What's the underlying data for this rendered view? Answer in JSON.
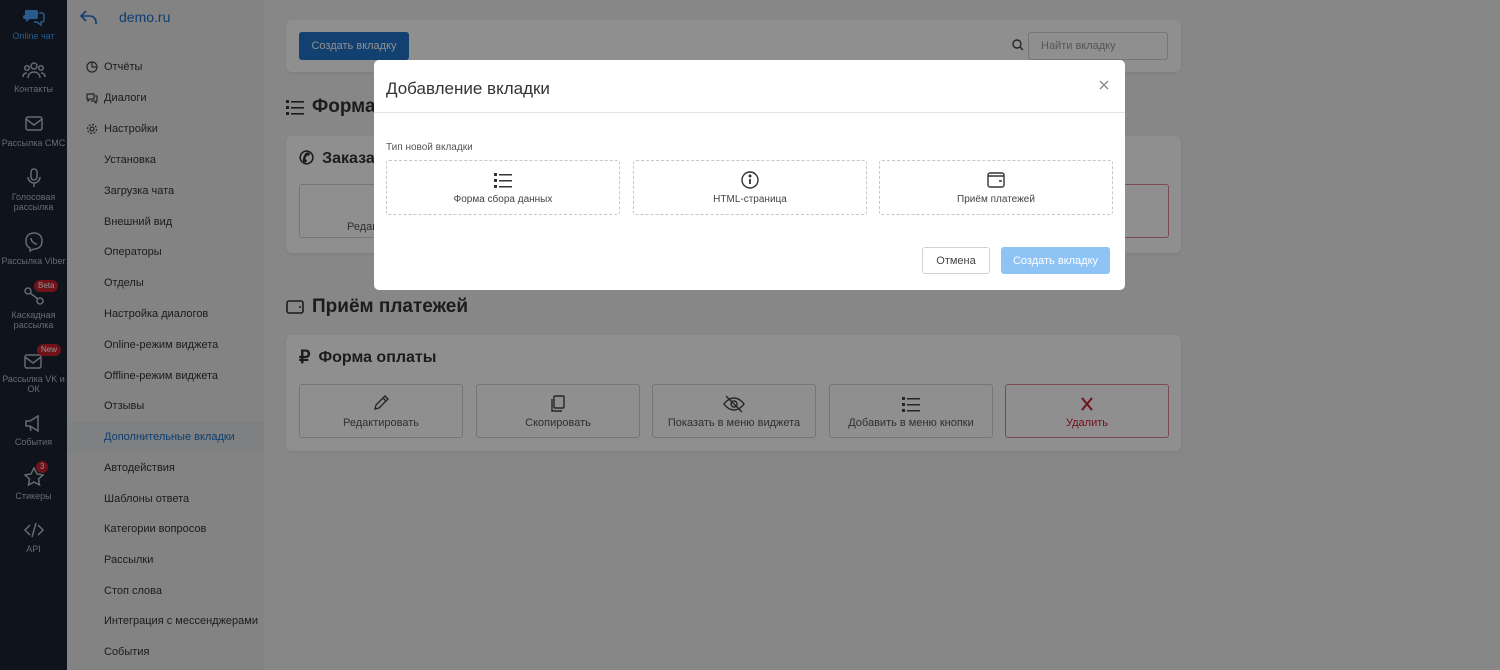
{
  "rail": {
    "items": [
      {
        "label": "Online чат",
        "icon": "chat-icon"
      },
      {
        "label": "Контакты",
        "icon": "contacts-icon"
      },
      {
        "label": "Рассылка СМС",
        "icon": "mail-icon"
      },
      {
        "label": "Голосовая рассылка",
        "icon": "microphone-icon"
      },
      {
        "label": "Рассылка Viber",
        "icon": "viber-icon"
      },
      {
        "label": "Каскадная рассылка",
        "icon": "cascade-icon",
        "badge": "Beta"
      },
      {
        "label": "Рассылка VK и ОК",
        "icon": "vk-ok-icon",
        "badge": "New"
      },
      {
        "label": "События",
        "icon": "megaphone-icon"
      },
      {
        "label": "Стикеры",
        "icon": "star-icon",
        "badge": "3"
      },
      {
        "label": "API",
        "icon": "code-icon"
      }
    ]
  },
  "sidebar": {
    "site": "demo.ru",
    "items": [
      {
        "label": "Отчёты",
        "icon": "reports-icon"
      },
      {
        "label": "Диалоги",
        "icon": "dialogs-icon"
      },
      {
        "label": "Настройки",
        "icon": "gear-icon"
      },
      {
        "label": "Установка"
      },
      {
        "label": "Загрузка чата"
      },
      {
        "label": "Внешний вид"
      },
      {
        "label": "Операторы"
      },
      {
        "label": "Отделы"
      },
      {
        "label": "Настройка диалогов"
      },
      {
        "label": "Online-режим виджета"
      },
      {
        "label": "Offline-режим виджета"
      },
      {
        "label": "Отзывы"
      },
      {
        "label": "Дополнительные вкладки",
        "active": true
      },
      {
        "label": "Автодействия"
      },
      {
        "label": "Шаблоны ответа"
      },
      {
        "label": "Категории вопросов"
      },
      {
        "label": "Рассылки"
      },
      {
        "label": "Стоп слова"
      },
      {
        "label": "Интеграция с мессенджерами"
      },
      {
        "label": "События"
      }
    ]
  },
  "toolbar": {
    "create_label": "Создать вкладку",
    "search_placeholder": "Найти вкладку"
  },
  "sections": {
    "form": {
      "title": "Форма",
      "card_title": "Заказат",
      "edit_partial": "Редак"
    },
    "payments": {
      "title": "Приём платежей",
      "card_title": "Форма оплаты",
      "actions": [
        {
          "label": "Редактировать",
          "icon": "pencil-icon"
        },
        {
          "label": "Скопировать",
          "icon": "copy-icon"
        },
        {
          "label": "Показать в меню виджета",
          "icon": "eye-off-icon"
        },
        {
          "label": "Добавить в меню кнопки",
          "icon": "list-icon"
        },
        {
          "label": "Удалить",
          "icon": "close-icon"
        }
      ]
    }
  },
  "modal": {
    "title": "Добавление вкладки",
    "type_label": "Тип новой вкладки",
    "options": [
      {
        "label": "Форма сбора данных",
        "icon": "list-icon"
      },
      {
        "label": "HTML-страница",
        "icon": "info-icon"
      },
      {
        "label": "Приём платежей",
        "icon": "wallet-icon"
      }
    ],
    "cancel_label": "Отмена",
    "create_label": "Создать вкладку"
  },
  "colors": {
    "accent": "#1f72c9",
    "rail_bg": "#1b2330",
    "danger": "#c8202f",
    "create_disabled": "#8dc3f5"
  }
}
